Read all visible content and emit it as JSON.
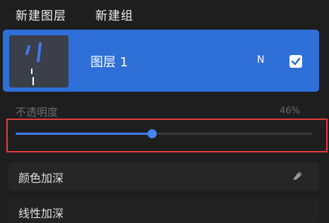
{
  "header": {
    "new_layer_label": "新建图层",
    "new_group_label": "新建组"
  },
  "layer": {
    "name": "图层 1",
    "blend_code": "N",
    "visible": true
  },
  "opacity": {
    "label": "不透明度",
    "value_text": "46%",
    "value": 0.46
  },
  "blend_modes": [
    {
      "label": "颜色加深"
    },
    {
      "label": "线性加深"
    }
  ],
  "colors": {
    "accent": "#2f6fd8",
    "slider": "#3f7ae8",
    "highlight": "#e23b3b",
    "background": "#1e1e1f"
  }
}
